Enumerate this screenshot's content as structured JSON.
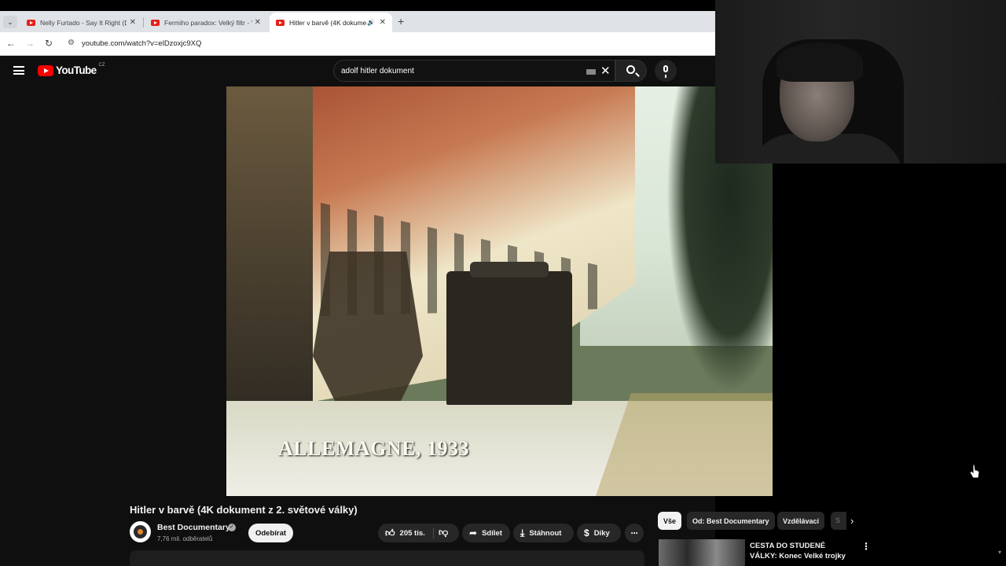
{
  "browser": {
    "tabs": [
      {
        "title": "Nelly Furtado - Say It Right (DA",
        "active": false
      },
      {
        "title": "Fermiho paradox: Velký filtr - Yo",
        "active": false
      },
      {
        "title": "Hitler v barvě (4K dokumen",
        "active": true
      }
    ],
    "new_tab_symbol": "+",
    "url": "youtube.com/watch?v=elDzoxjc9XQ"
  },
  "youtube": {
    "logo_text": "YouTube",
    "country_code": "CZ",
    "search_query": "adolf hitler dokument"
  },
  "video": {
    "caption": "ALLEMAGNE, 1933",
    "title": "Hitler v barvě (4K dokument z 2. světové války)",
    "channel_name": "Best Documentary",
    "subscribers": "7,76 mil. odběratelů",
    "subscribe_label": "Odebírat",
    "likes": "205 tis.",
    "share_label": "Sdílet",
    "download_label": "Stáhnout",
    "thanks_label": "Díky"
  },
  "sidebar": {
    "chips": [
      "Vše",
      "Od: Best Documentary",
      "Vzdělávací",
      "S"
    ],
    "recommendation_title": "CESTA DO STUDENÉ VÁLKY: Konec Velké trojky"
  },
  "icons": {
    "tab_favicon": "youtube-icon",
    "back": "arrow-left-icon",
    "forward": "arrow-right-icon",
    "reload": "reload-icon",
    "search": "search-icon",
    "mic": "microphone-icon",
    "like": "thumbs-up-icon",
    "dislike": "thumbs-down-icon",
    "share": "share-icon",
    "download": "download-icon",
    "thanks": "thanks-icon"
  },
  "colors": {
    "youtube_red": "#ff0000",
    "background": "#0f0f0f",
    "pill": "#272727"
  }
}
